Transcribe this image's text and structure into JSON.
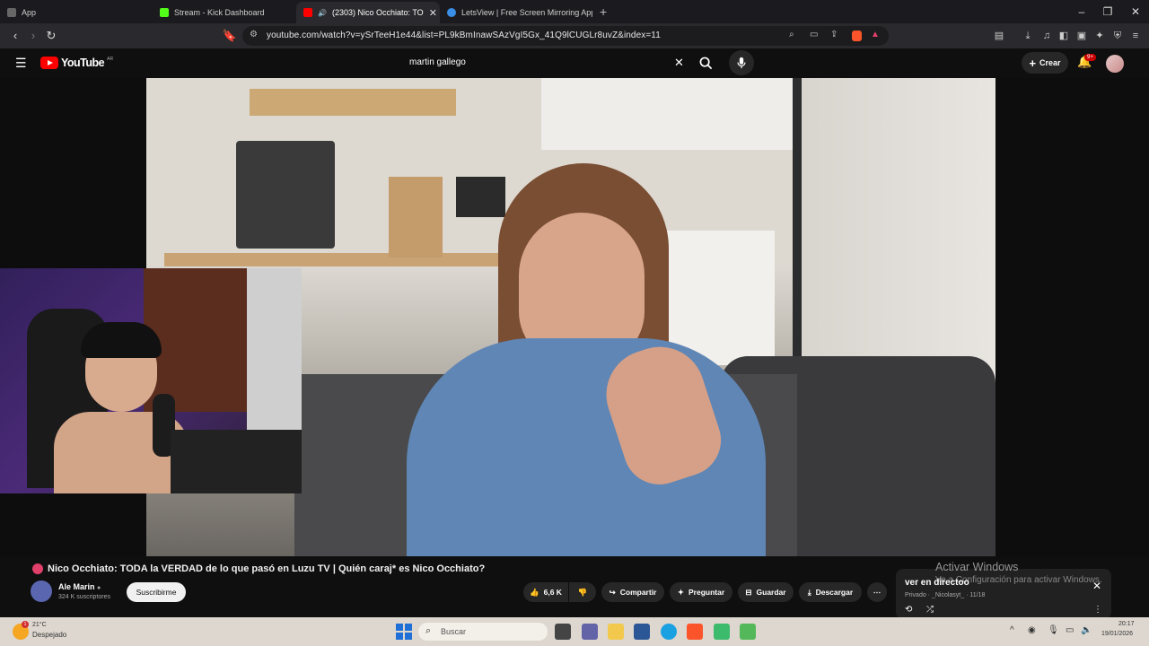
{
  "browser": {
    "tabs": [
      {
        "label": "App",
        "icon": "app-icon"
      },
      {
        "label": "Stream - Kick Dashboard",
        "icon": "kick-icon"
      },
      {
        "label": "(2303) Nico Occhiato: TO",
        "icon": "youtube-icon",
        "active": true
      },
      {
        "label": "LetsView | Free Screen Mirroring App",
        "icon": "letsview-icon"
      }
    ],
    "url": "youtube.com/watch?v=ySrTeeH1e44&list=PL9kBmInawSAzVgI5Gx_41Q9lCUGLr8uvZ&index=11"
  },
  "youtube": {
    "logo_text": "YouTube",
    "country": "AR",
    "search_value": "martin gallego",
    "create_label": "Crear",
    "notif_count": "9+"
  },
  "video": {
    "title": "Nico Occhiato: TODA la VERDAD de lo que pasó en Luzu TV | Quién caraj* es Nico Occhiato?",
    "channel": "Ale Marin",
    "subscribers": "324 K suscriptores",
    "subscribe_label": "Suscribirme",
    "likes": "6,6 K",
    "share_label": "Compartir",
    "ask_label": "Preguntar",
    "save_label": "Guardar",
    "download_label": "Descargar"
  },
  "playlist": {
    "title": "ver en directoo",
    "meta": "Privado · _Nicolasyt_ · 11/18"
  },
  "windows_activation": {
    "title": "Activar Windows",
    "subtitle": "Ve a Configuración para activar Windows."
  },
  "taskbar": {
    "weather_temp": "21°C",
    "weather_desc": "Despejado",
    "search_placeholder": "Buscar",
    "time": "20:17",
    "date": "19/01/2026"
  },
  "colors": {
    "youtube_red": "#ff0000",
    "bg": "#0f0f0f",
    "pill": "#272727"
  }
}
